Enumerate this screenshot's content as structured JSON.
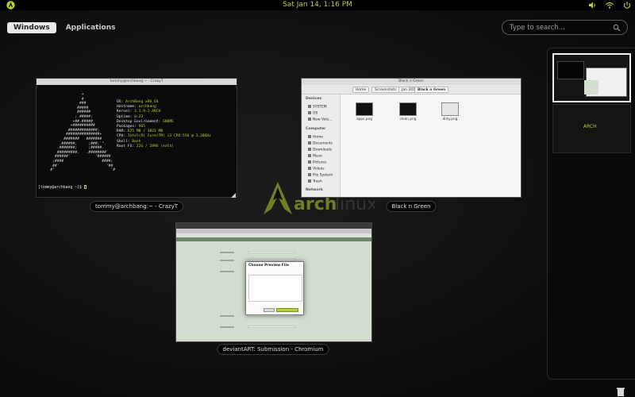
{
  "top_bar": {
    "activities_icon": "arch-logo-icon",
    "clock": "Sat Jan 14,  1:16 PM",
    "tray_icons": [
      "volume-icon",
      "wifi-icon",
      "power-icon"
    ]
  },
  "view_tabs": [
    {
      "label": "Windows",
      "active": true
    },
    {
      "label": "Applications",
      "active": false
    }
  ],
  "search": {
    "placeholder": "Type to search..."
  },
  "windows": {
    "terminal": {
      "caption": "tommy@archbang:~ - CrazyT",
      "prompt": "[tommy@archbang ~]$ ",
      "info": [
        {
          "k": "OS: ",
          "v": "ArchBang x86_64"
        },
        {
          "k": "Hostname: ",
          "v": "archbang"
        },
        {
          "k": "Kernel: ",
          "v": "3.1.9-2-ARCH"
        },
        {
          "k": "Uptime: ",
          "v": "0:23"
        },
        {
          "k": "Desktop Environment: ",
          "v": "GNOME"
        },
        {
          "k": "Packages: ",
          "v": "965"
        },
        {
          "k": "RAM: ",
          "v": "675 MB / 3821 MB"
        },
        {
          "k": "CPU: ",
          "v": "Intel(R) Core(TM) i3 CPU 550 @ 3.20GHz"
        },
        {
          "k": "Shell: ",
          "v": "Bash"
        },
        {
          "k": "Root FS: ",
          "v": "22G / 289G (ext4)"
        }
      ]
    },
    "file_manager": {
      "caption": "Black n Green",
      "title": "Black n Green",
      "breadcrumbs": [
        "Home",
        "Screenshots",
        "Jan 2012",
        "Black n Green"
      ],
      "sidebar": {
        "devices_heading": "Devices",
        "devices": [
          "SYSTEM",
          "OS",
          "New Volu..."
        ],
        "computer_heading": "Computer",
        "computer": [
          "Home",
          "Documents",
          "Downloads",
          "Music",
          "Pictures",
          "Videos",
          "File System",
          "Trash"
        ],
        "network_heading": "Network"
      },
      "files": [
        "apps.png",
        "clean.png",
        "dirty.png"
      ]
    },
    "chromium": {
      "caption": "deviantART: Submission - Chromium",
      "dialog_title": "Choose Preview File"
    }
  },
  "workspace_logo_text": "ARCH",
  "colors": {
    "accent": "#b5d334",
    "panel": "#000000",
    "background": "#0c0c0c"
  }
}
